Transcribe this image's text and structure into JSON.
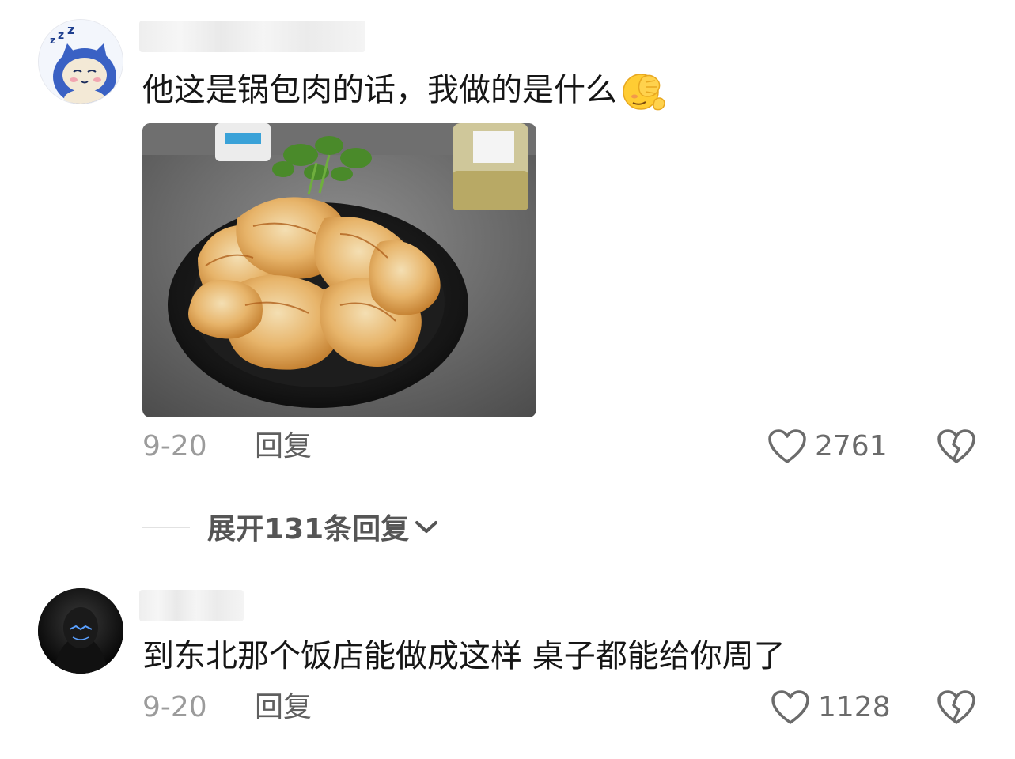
{
  "comments": [
    {
      "text": "他这是锅包肉的话，我做的是什么",
      "emoji": "facepalm-emoji",
      "image": "fried-pork-dish-photo",
      "date": "9-20",
      "reply_label": "回复",
      "likes": "2761"
    },
    {
      "text": "到东北那个饭店能做成这样 桌子都能给你周了",
      "date": "9-20",
      "reply_label": "回复",
      "likes": "1128"
    }
  ],
  "expand_replies_label": "展开131条回复",
  "icons": {
    "like": "heart-outline-icon",
    "dislike": "broken-heart-icon",
    "expand": "chevron-down-icon"
  },
  "colors": {
    "text_primary": "#161616",
    "text_secondary": "#9b9b9b",
    "action_text": "#5f5f5f"
  }
}
